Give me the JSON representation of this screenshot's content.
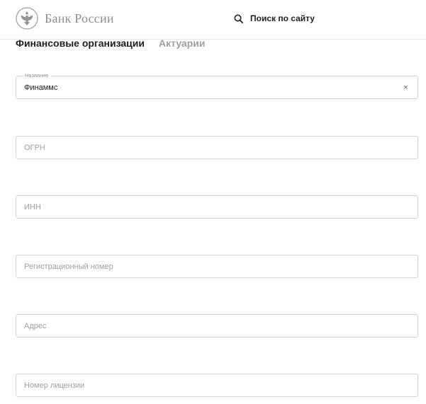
{
  "header": {
    "logo_text": "Банк России",
    "search_label": "Поиск по сайту"
  },
  "tabs": [
    {
      "label": "Финансовые организации",
      "active": true
    },
    {
      "label": "Актуарии",
      "active": false
    }
  ],
  "form": {
    "name": {
      "label": "Название",
      "value": "Финаммс",
      "clear_glyph": "×"
    },
    "ogrn": {
      "placeholder": "ОГРН"
    },
    "inn": {
      "placeholder": "ИНН"
    },
    "reg_number": {
      "placeholder": "Регистрационный номер"
    },
    "address": {
      "placeholder": "Адрес"
    },
    "license_number": {
      "placeholder": "Номер лицензии"
    }
  },
  "colors": {
    "logo_gray": "#8c8f94",
    "inactive_tab": "#9aa0a6",
    "border": "#cfd3d6"
  }
}
